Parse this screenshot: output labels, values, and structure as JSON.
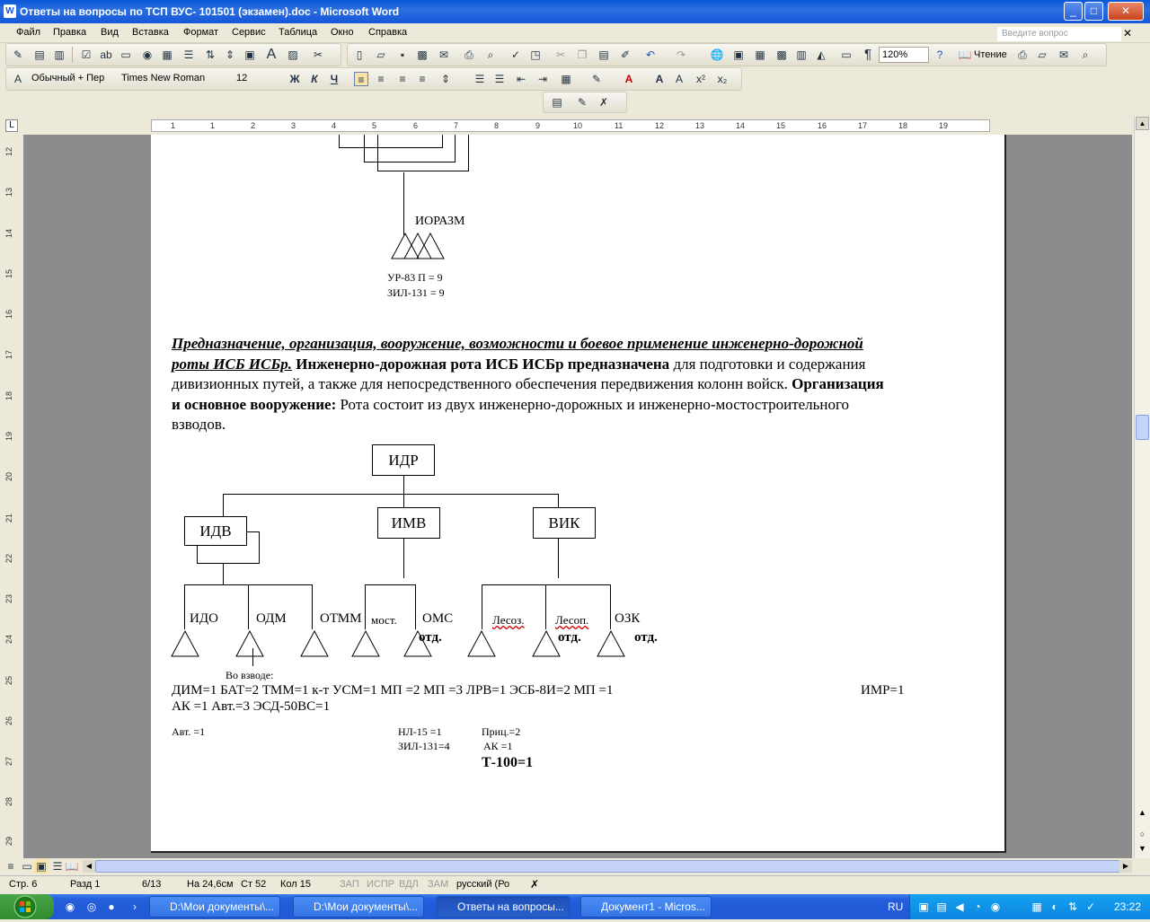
{
  "window": {
    "title": "Ответы на вопросы по ТСП ВУС- 101501 (экзамен).doc - Microsoft Word"
  },
  "menu": {
    "items": [
      "Файл",
      "Правка",
      "Вид",
      "Вставка",
      "Формат",
      "Сервис",
      "Таблица",
      "Окно",
      "Справка"
    ],
    "ask_placeholder": "Введите вопрос"
  },
  "toolbar": {
    "zoom": "120%",
    "reading": "Чтение",
    "style": "Обычный + Пер",
    "font": "Times New Roman",
    "size": "12"
  },
  "ruler": {
    "h": [
      "1",
      "1",
      "2",
      "3",
      "4",
      "5",
      "6",
      "7",
      "8",
      "9",
      "10",
      "11",
      "12",
      "13",
      "14",
      "15",
      "16",
      "17",
      "18",
      "19"
    ],
    "v": [
      "12",
      "13",
      "14",
      "15",
      "16",
      "17",
      "18",
      "19",
      "20",
      "21",
      "22",
      "23",
      "24",
      "25",
      "26",
      "27",
      "28",
      "29"
    ]
  },
  "doc": {
    "top_label": "ИОРАЗМ",
    "ur": "УР-83 П = 9",
    "zil": "ЗИЛ-131 = 9",
    "p1_bi": "Предназначение, организация, вооружение, возможности и боевое применение инженерно-дорожной",
    "p2_bi": "роты ИСБ ИСБр.",
    "p2_b": " Инженерно-дорожная рота ИСБ ИСБр предназначена",
    "p2_n": " для подготовки и содержания",
    "p3": "дивизионных путей, а также для непосредственного обеспечения передвижения колонн войск.",
    "p3_b": " Организация",
    "p4_b": "и основное  вооружение:",
    "p4_n": " Рота состоит из двух инженерно-дорожных и инженерно-мостостроительного",
    "p5": "взводов.",
    "org": {
      "root": "ИДР",
      "units": [
        "ИДВ",
        "ИМВ",
        "ВИК"
      ],
      "sub": [
        "ИДО",
        "ОДМ",
        "ОТММ",
        "мост.",
        "ОМС",
        "Лесоз.",
        "Лесоп.",
        "ОЗК"
      ],
      "otd": [
        "отд.",
        "отд.",
        "отд."
      ]
    },
    "platoon": "Во взводе:",
    "row1": "ДИМ=1    БАТ=2    ТММ=1 к-т  УСМ=1  МП  =2   МП =3     ЛРВ=1    ЭСБ-8И=2 МП  =1",
    "imr": "ИМР=1",
    "row2": "АК    =1   Авт.=3    ЭСД-50ВС=1",
    "avt": "Авт. =1",
    "nl": "НЛ-15    =1",
    "pric": "Приц.=2",
    "zil2": "ЗИЛ-131=4",
    "ak": "АК     =1",
    "t100": "Т-100=1"
  },
  "status": {
    "page": "Стр. 6",
    "section": "Разд  1",
    "pages": "6/13",
    "pos": "На 24,6см",
    "line": "Ст  52",
    "col": "Кол  15",
    "rec": "ЗАП",
    "trk": "ИСПР",
    "ext": "ВДЛ",
    "ovr": "ЗАМ",
    "lang": "русский (Ро"
  },
  "taskbar": {
    "tasks": [
      "D:\\Мои документы\\...",
      "D:\\Мои документы\\...",
      "Ответы на вопросы...",
      "Документ1 - Micros..."
    ],
    "lang": "RU",
    "time": "23:22"
  },
  "colors": {
    "title": "#1556d8",
    "taskbar": "#245edb"
  }
}
